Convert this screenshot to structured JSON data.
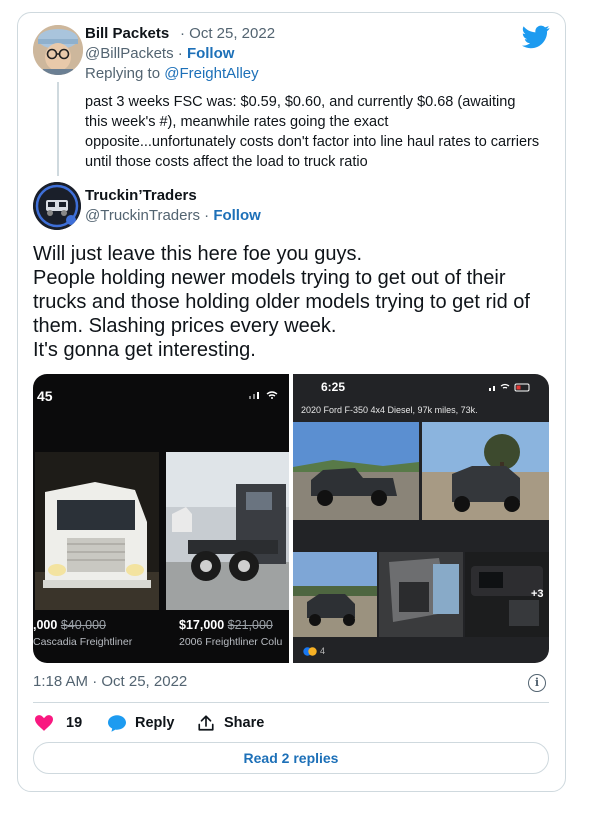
{
  "colors": {
    "twitter_blue": "#1d9bf0",
    "like_pink": "#f91880",
    "link_blue": "#1d70b8",
    "muted": "#536471"
  },
  "reply_tweet": {
    "author_name": "Bill Packets",
    "date": "· Oct 25, 2022",
    "handle": "@BillPackets",
    "separator": "·",
    "follow": "Follow",
    "replying_prefix": "Replying to ",
    "replying_to": "@FreightAlley",
    "body": "past 3 weeks FSC was: $0.59, $0.60, and currently $0.68 (awaiting this week's #), meanwhile rates going the exact opposite...unfortunately costs don't factor into line haul rates to carriers until those costs affect the load to truck ratio"
  },
  "main_tweet": {
    "author_name": "Truckin’Traders",
    "handle": "@TruckinTraders",
    "separator": "·",
    "follow": "Follow",
    "lines": [
      "Will just leave this here foe you guys.",
      "People holding newer models trying to get out of their",
      "trucks and those holding older models trying to get rid of",
      "them. Slashing prices every week.",
      "It's gonna get interesting."
    ],
    "timestamp": "1:18 AM · Oct 25, 2022"
  },
  "media": {
    "left": {
      "status_time": "45",
      "listing1_price": ",000",
      "listing1_old_price": "$40,000",
      "listing1_title": "Cascadia  Freightliner",
      "listing2_price": "$17,000",
      "listing2_old_price": "$21,000",
      "listing2_title": "2006 Freightliner  Colu"
    },
    "right": {
      "status_time": "6:25",
      "caption": "2020 Ford F-350 4x4 Diesel, 97k miles, 73k.",
      "more_photos": "+3",
      "reactions": "4"
    }
  },
  "actions": {
    "likes": "19",
    "reply": "Reply",
    "share": "Share"
  },
  "read_replies": "Read 2 replies"
}
